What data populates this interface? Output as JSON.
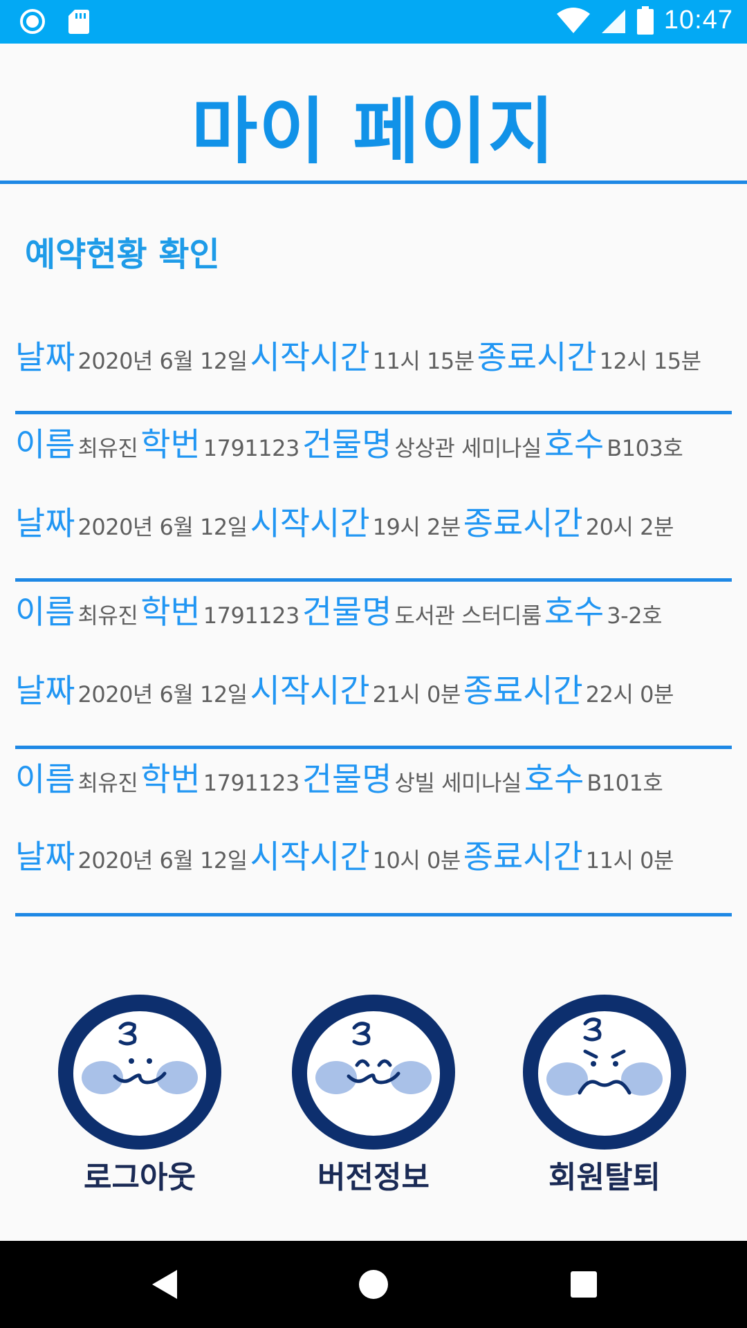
{
  "status_bar": {
    "time": "10:47",
    "left_icons": [
      "radio-button-icon",
      "sd-card-icon"
    ],
    "right_icons": [
      "wifi-icon",
      "signal-icon",
      "battery-icon"
    ]
  },
  "page_title": "마이 페이지",
  "section_title": "예약현황 확인",
  "labels": {
    "date": "날짜",
    "start_time": "시작시간",
    "end_time": "종료시간",
    "name": "이름",
    "student_id": "학번",
    "building": "건물명",
    "room": "호수"
  },
  "first_schedule": {
    "date": "2020년 6월 12일",
    "start_time": "11시 15분",
    "end_time": "12시 15분"
  },
  "reservations": [
    {
      "name": "최유진",
      "student_id": "1791123",
      "building": "상상관 세미나실",
      "room": "B103호",
      "date": "2020년 6월 12일",
      "start_time": "19시 2분",
      "end_time": "20시 2분"
    },
    {
      "name": "최유진",
      "student_id": "1791123",
      "building": "도서관 스터디룸",
      "room": "3-2호",
      "date": "2020년 6월 12일",
      "start_time": "21시 0분",
      "end_time": "22시 0분"
    },
    {
      "name": "최유진",
      "student_id": "1791123",
      "building": "상빌 세미나실",
      "room": "B101호",
      "date": "2020년 6월 12일",
      "start_time": "10시 0분",
      "end_time": "11시 0분"
    }
  ],
  "buttons": {
    "logout": "로그아웃",
    "version": "버전정보",
    "withdraw": "회원탈퇴"
  },
  "nav": [
    "back-icon",
    "home-icon",
    "recents-icon"
  ],
  "colors": {
    "status_bar": "#03a9f4",
    "accent": "#2196f3",
    "divider": "#1e88e5",
    "face_ring": "#0d2f6e",
    "cheek": "#a9c1e8"
  }
}
